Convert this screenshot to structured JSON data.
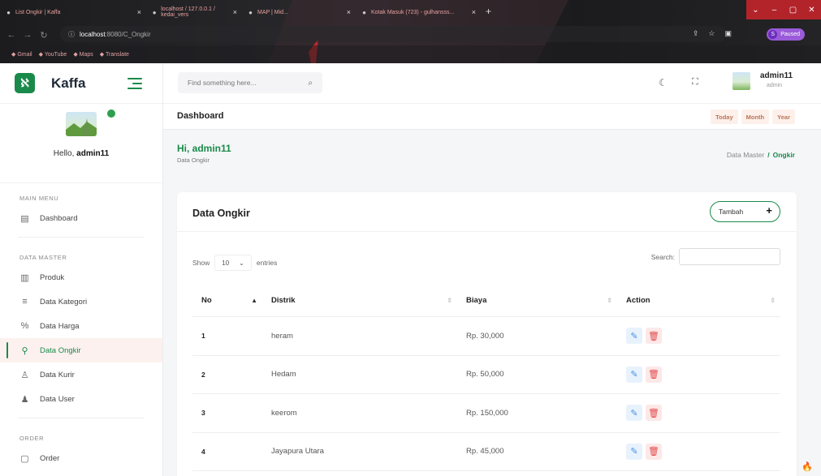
{
  "browser": {
    "tabs": [
      {
        "label": "List Ongkir | Kaffa",
        "width": 180
      },
      {
        "label": "localhost / 127.0.0.1 / kedai_vers",
        "width": 118
      },
      {
        "label": "MAP | Mid...",
        "width": 140
      },
      {
        "label": "Kotak Masuk (723) - gulhansss...",
        "width": 154
      }
    ],
    "new_tab": "+",
    "url_host": "localhost",
    "url_path": ":8080/C_Ongkir",
    "profile_letter": "S",
    "profile_status": "Paused",
    "bookmarks": [
      "Gmail",
      "YouTube",
      "Maps",
      "Translate"
    ]
  },
  "sidebar": {
    "brand": "Kaffa",
    "hello_prefix": "Hello, ",
    "hello_name": "admin11",
    "sections": [
      {
        "title": "MAIN MENU",
        "items": [
          {
            "label": "Dashboard",
            "icon": "dashboard-icon",
            "glyph": "▤",
            "active": false
          }
        ]
      },
      {
        "title": "DATA MASTER",
        "items": [
          {
            "label": "Produk",
            "icon": "product-icon",
            "glyph": "▥",
            "active": false
          },
          {
            "label": "Data Kategori",
            "icon": "list-icon",
            "glyph": "≡",
            "active": false
          },
          {
            "label": "Data Harga",
            "icon": "percent-icon",
            "glyph": "%",
            "active": false
          },
          {
            "label": "Data Ongkir",
            "icon": "route-icon",
            "glyph": "⚲",
            "active": true
          },
          {
            "label": "Data Kurir",
            "icon": "user-icon",
            "glyph": "♙",
            "active": false
          },
          {
            "label": "Data User",
            "icon": "users-icon",
            "glyph": "♟",
            "active": false
          }
        ]
      },
      {
        "title": "ORDER",
        "items": [
          {
            "label": "Order",
            "icon": "order-icon",
            "glyph": "▢",
            "active": false
          }
        ]
      }
    ]
  },
  "topbar": {
    "search_placeholder": "Find something here...",
    "user_name": "admin11",
    "user_role": "admin"
  },
  "subbar": {
    "title": "Dashboard",
    "ranges": [
      "Today",
      "Month",
      "Year"
    ]
  },
  "page": {
    "greeting": "Hi, admin11",
    "subtitle": "Data Ongkir",
    "breadcrumb_parent": "Data Master",
    "breadcrumb_current": "Ongkir"
  },
  "card": {
    "title": "Data Ongkir",
    "add_label": "Tambah",
    "show_label": "Show",
    "page_length": "10",
    "entries_label": "entries",
    "search_label": "Search:",
    "columns": [
      "No",
      "Distrik",
      "Biaya",
      "Action"
    ],
    "rows": [
      {
        "no": "1",
        "distrik": "heram",
        "biaya": "Rp. 30,000"
      },
      {
        "no": "2",
        "distrik": "Hedam",
        "biaya": "Rp. 50,000"
      },
      {
        "no": "3",
        "distrik": "keerom",
        "biaya": "Rp. 150,000"
      },
      {
        "no": "4",
        "distrik": "Jayapura Utara",
        "biaya": "Rp. 45,000"
      }
    ]
  },
  "colors": {
    "accent": "#1a8a4a",
    "edit": "#4a90e2",
    "delete": "#e24a4a"
  }
}
